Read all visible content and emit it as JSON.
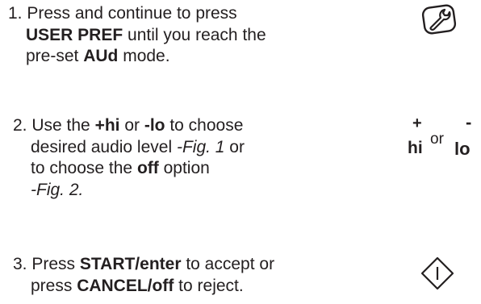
{
  "steps": [
    {
      "lines": [
        [
          {
            "t": "1. Press and continue to press",
            "s": "n"
          }
        ],
        [
          {
            "t": "USER PREF",
            "s": "b"
          },
          {
            "t": " until you reach the",
            "s": "n"
          }
        ],
        [
          {
            "t": "pre-set ",
            "s": "n"
          },
          {
            "t": "AUd",
            "s": "b"
          },
          {
            "t": " mode.",
            "s": "n"
          }
        ]
      ],
      "icon": "wrench-icon"
    },
    {
      "lines": [
        [
          {
            "t": "2. Use the ",
            "s": "n"
          },
          {
            "t": "+hi",
            "s": "b"
          },
          {
            "t": " or ",
            "s": "n"
          },
          {
            "t": "-lo",
            "s": "b"
          },
          {
            "t": " to choose",
            "s": "n"
          }
        ],
        [
          {
            "t": "desired audio level ",
            "s": "n"
          },
          {
            "t": "-Fig. 1",
            "s": "i"
          },
          {
            "t": " or",
            "s": "n"
          }
        ],
        [
          {
            "t": "to choose the ",
            "s": "n"
          },
          {
            "t": "off",
            "s": "b"
          },
          {
            "t": " option",
            "s": "n"
          }
        ],
        [
          {
            "t": "-Fig. 2.",
            "s": "i"
          }
        ]
      ],
      "icon": "hi-lo-buttons-icon",
      "icon_text": {
        "plus": "+",
        "minus": "-",
        "hi": "hi",
        "or": "or",
        "lo": "lo"
      }
    },
    {
      "lines": [
        [
          {
            "t": "3. Press ",
            "s": "n"
          },
          {
            "t": "START/enter",
            "s": "b"
          },
          {
            "t": "  to accept or",
            "s": "n"
          }
        ],
        [
          {
            "t": "press ",
            "s": "n"
          },
          {
            "t": "CANCEL/off",
            "s": "b"
          },
          {
            "t": " to reject.",
            "s": "n"
          }
        ]
      ],
      "icon": "start-button-icon"
    }
  ]
}
